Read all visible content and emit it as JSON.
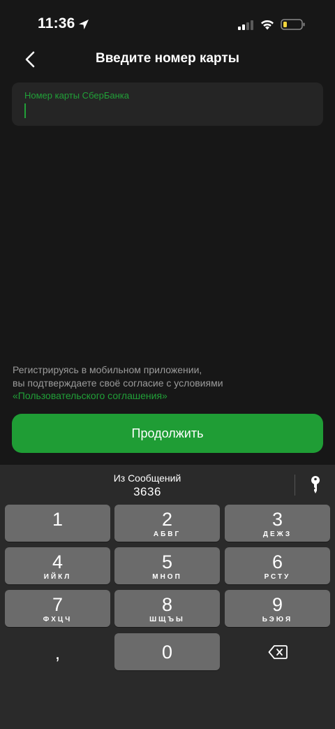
{
  "status_bar": {
    "time": "11:36",
    "icons": [
      "location-arrow-icon",
      "signal-icon",
      "wifi-icon",
      "battery-icon"
    ]
  },
  "header": {
    "back_icon": "chevron-left-icon",
    "title": "Введите номер карты"
  },
  "card_field": {
    "label": "Номер карты СберБанка",
    "value": ""
  },
  "consent": {
    "line1": "Регистрируясь в мобильном приложении,",
    "line2": "вы подтверждаете своё согласие с условиями",
    "link": "«Пользовательского соглашения»"
  },
  "continue_button": {
    "label": "Продолжить"
  },
  "keyboard": {
    "suggestion": {
      "source": "Из Сообщений",
      "code": "3636"
    },
    "key_icon": "key-icon",
    "keys": [
      {
        "digit": "1",
        "letters": ""
      },
      {
        "digit": "2",
        "letters": "АБВГ"
      },
      {
        "digit": "3",
        "letters": "ДЕЖЗ"
      },
      {
        "digit": "4",
        "letters": "ИЙКЛ"
      },
      {
        "digit": "5",
        "letters": "МНОП"
      },
      {
        "digit": "6",
        "letters": "РСТУ"
      },
      {
        "digit": "7",
        "letters": "ФХЦЧ"
      },
      {
        "digit": "8",
        "letters": "ШЩЪЫ"
      },
      {
        "digit": "9",
        "letters": "ЬЭЮЯ"
      },
      {
        "digit": "0",
        "letters": ""
      }
    ],
    "comma": ",",
    "delete_icon": "backspace-icon"
  },
  "colors": {
    "background": "#171717",
    "accent_green": "#21a038",
    "button_green": "#1f9d35",
    "keyboard_bg": "#2a2a2a",
    "key_bg": "#6b6b6b"
  }
}
